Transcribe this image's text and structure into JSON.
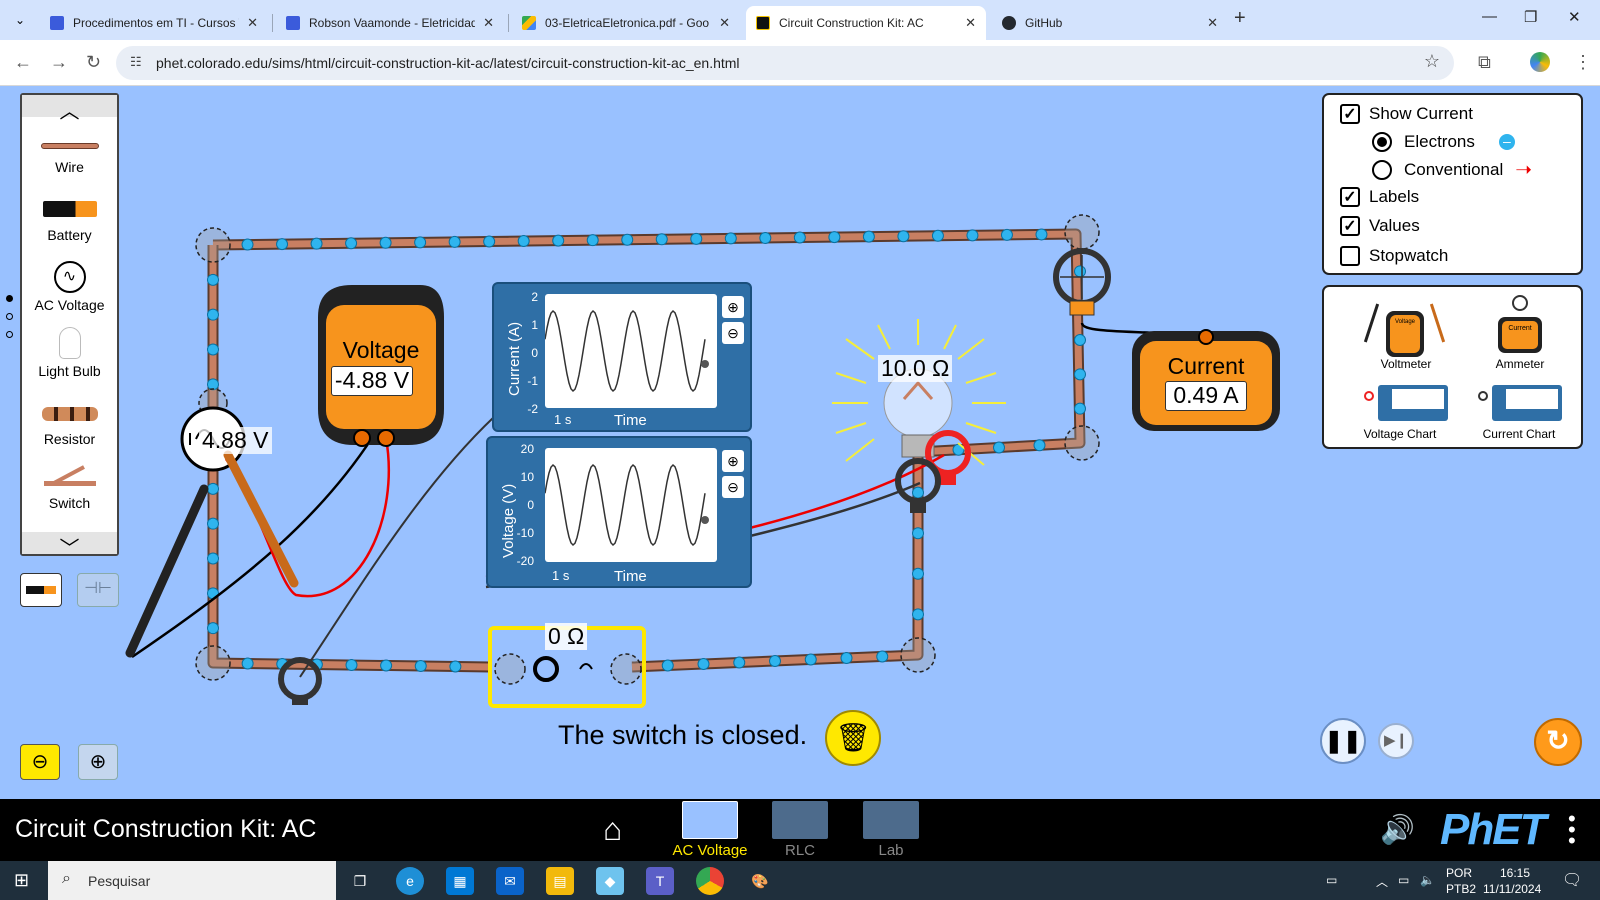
{
  "browser": {
    "tabs": [
      {
        "title": "Procedimentos em TI - Cursos T",
        "active": false
      },
      {
        "title": "Robson Vaamonde - Eletricidad",
        "active": false
      },
      {
        "title": "03-EletricaEletronica.pdf - Goo",
        "active": false
      },
      {
        "title": "Circuit Construction Kit: AC",
        "active": true
      },
      {
        "title": "GitHub",
        "active": false
      }
    ],
    "url": "phet.colorado.edu/sims/html/circuit-construction-kit-ac/latest/circuit-construction-kit-ac_en.html"
  },
  "toolbox": {
    "items": [
      {
        "label": "Wire"
      },
      {
        "label": "Battery"
      },
      {
        "label": "AC Voltage"
      },
      {
        "label": "Light Bulb"
      },
      {
        "label": "Resistor"
      },
      {
        "label": "Switch"
      }
    ]
  },
  "controls": {
    "show_current": {
      "label": "Show Current",
      "checked": true
    },
    "electrons": {
      "label": "Electrons",
      "selected": true
    },
    "conventional": {
      "label": "Conventional",
      "selected": false
    },
    "labels": {
      "label": "Labels",
      "checked": true
    },
    "values": {
      "label": "Values",
      "checked": true
    },
    "stopwatch": {
      "label": "Stopwatch",
      "checked": false
    }
  },
  "sensors": {
    "voltmeter": "Voltmeter",
    "ammeter": "Ammeter",
    "voltage_chart": "Voltage Chart",
    "current_chart": "Current Chart",
    "voltmeter_icon_text": "Voltage",
    "ammeter_icon_text": "Current"
  },
  "voltmeter": {
    "title": "Voltage",
    "reading": "-4.88 V"
  },
  "ammeter": {
    "title": "Current",
    "reading": "0.49 A"
  },
  "current_chart": {
    "ylabel": "Current (A)",
    "xlabel": "Time",
    "scale": "1 s",
    "yticks": [
      "2",
      "1",
      "0",
      "-1",
      "-2"
    ]
  },
  "voltage_chart": {
    "ylabel": "Voltage (V)",
    "xlabel": "Time",
    "scale": "1 s",
    "yticks": [
      "20",
      "10",
      "0",
      "-10",
      "-20"
    ]
  },
  "circuit_labels": {
    "ac_source": "4.88 V",
    "bulb": "10.0 Ω",
    "resistor": "0 Ω"
  },
  "status": "The switch is closed.",
  "nav": {
    "sim_title": "Circuit Construction Kit: AC",
    "screens": [
      {
        "label": "AC Voltage",
        "active": true
      },
      {
        "label": "RLC",
        "active": false
      },
      {
        "label": "Lab",
        "active": false
      }
    ],
    "logo": "PhET"
  },
  "taskbar": {
    "search_placeholder": "Pesquisar",
    "lang": "POR",
    "layout": "PTB2",
    "time": "16:15",
    "date": "11/11/2024"
  },
  "colors": {
    "sim_background": "#99c1ff",
    "meter_orange": "#f7941d",
    "wire_copper": "#c87f62",
    "electron_blue": "#2fb4ee",
    "highlight_yellow": "#ffe800"
  }
}
